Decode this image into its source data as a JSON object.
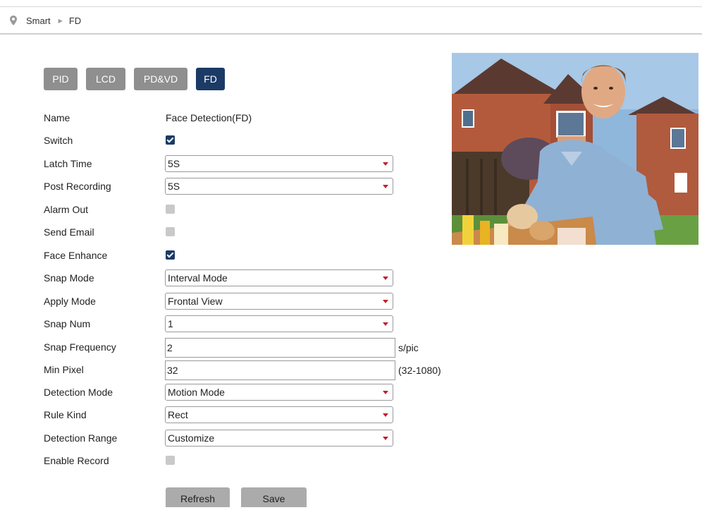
{
  "breadcrumb": {
    "items": [
      "Smart",
      "FD"
    ]
  },
  "tabs": [
    {
      "label": "PID",
      "active": false
    },
    {
      "label": "LCD",
      "active": false
    },
    {
      "label": "PD&VD",
      "active": false
    },
    {
      "label": "FD",
      "active": true
    }
  ],
  "form": {
    "name": {
      "label": "Name",
      "value": "Face Detection(FD)"
    },
    "switch": {
      "label": "Switch",
      "checked": true
    },
    "latch_time": {
      "label": "Latch Time",
      "value": "5S"
    },
    "post_recording": {
      "label": "Post Recording",
      "value": "5S"
    },
    "alarm_out": {
      "label": "Alarm Out",
      "checked": false
    },
    "send_email": {
      "label": "Send Email",
      "checked": false
    },
    "face_enhance": {
      "label": "Face Enhance",
      "checked": true
    },
    "snap_mode": {
      "label": "Snap Mode",
      "value": "Interval Mode"
    },
    "apply_mode": {
      "label": "Apply Mode",
      "value": "Frontal View"
    },
    "snap_num": {
      "label": "Snap Num",
      "value": "1"
    },
    "snap_frequency": {
      "label": "Snap Frequency",
      "value": "2",
      "unit": "s/pic"
    },
    "min_pixel": {
      "label": "Min Pixel",
      "value": "32",
      "unit": "(32-1080)"
    },
    "detection_mode": {
      "label": "Detection Mode",
      "value": "Motion Mode"
    },
    "rule_kind": {
      "label": "Rule Kind",
      "value": "Rect"
    },
    "detection_range": {
      "label": "Detection Range",
      "value": "Customize"
    },
    "enable_record": {
      "label": "Enable Record",
      "checked": false
    }
  },
  "buttons": {
    "refresh": "Refresh",
    "save": "Save"
  },
  "colors": {
    "accent": "#1b3a66",
    "tab_inactive": "#8f8f8f",
    "dropdown_arrow": "#c0202a",
    "button": "#ababab"
  }
}
